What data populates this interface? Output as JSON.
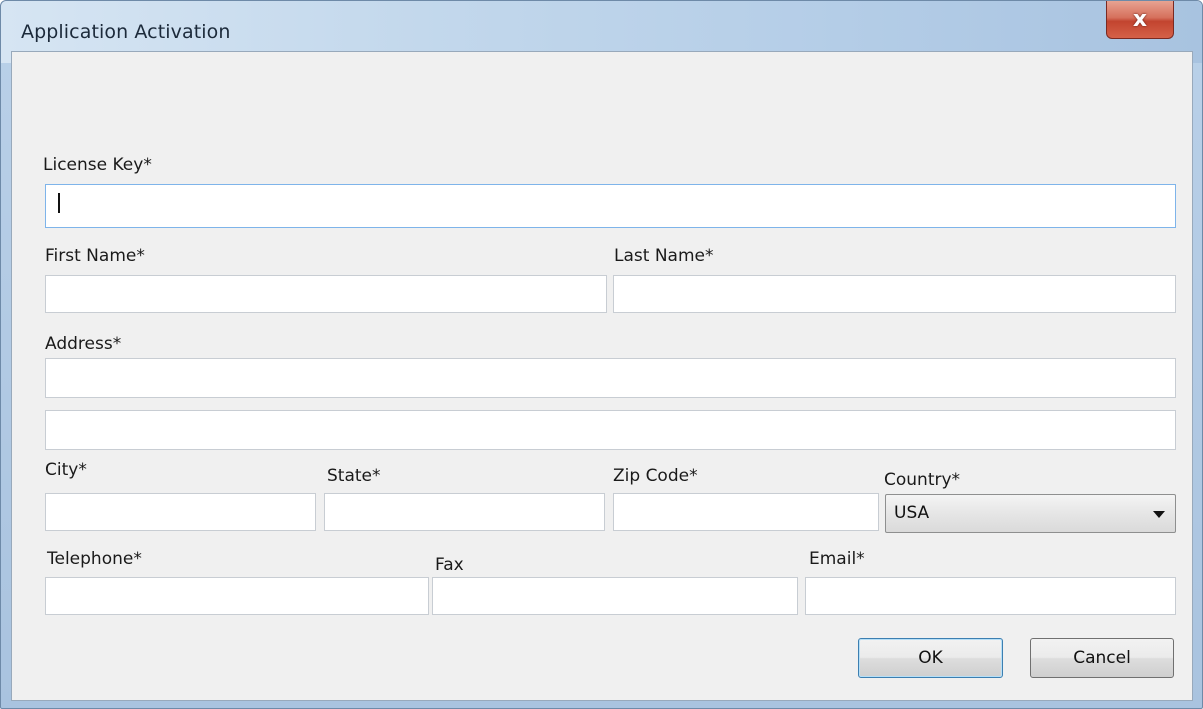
{
  "window": {
    "title": "Application Activation",
    "close_symbol": "x"
  },
  "form": {
    "license_key": {
      "label": "License Key*",
      "value": ""
    },
    "first_name": {
      "label": "First Name*",
      "value": ""
    },
    "last_name": {
      "label": "Last Name*",
      "value": ""
    },
    "address": {
      "label": "Address*",
      "line1": "",
      "line2": ""
    },
    "city": {
      "label": "City*",
      "value": ""
    },
    "state": {
      "label": "State*",
      "value": ""
    },
    "zip": {
      "label": "Zip Code*",
      "value": ""
    },
    "country": {
      "label": "Country*",
      "value": "USA"
    },
    "telephone": {
      "label": "Telephone*",
      "value": ""
    },
    "fax": {
      "label": "Fax",
      "value": ""
    },
    "email": {
      "label": "Email*",
      "value": ""
    }
  },
  "buttons": {
    "ok": "OK",
    "cancel": "Cancel"
  },
  "colors": {
    "accent_focus": "#7eb4ea",
    "close_button": "#c2442f"
  }
}
